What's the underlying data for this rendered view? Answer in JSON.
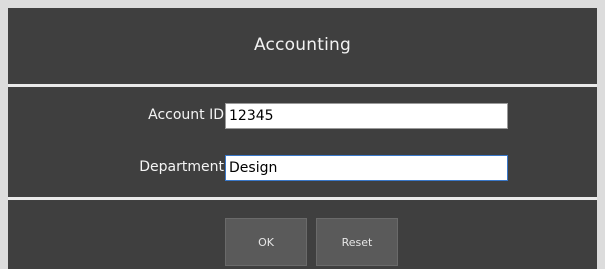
{
  "header": {
    "title": "Accounting"
  },
  "form": {
    "account_id": {
      "label": "Account ID",
      "value": "12345"
    },
    "department": {
      "label": "Department",
      "value": "Design"
    }
  },
  "buttons": {
    "ok_label": "OK",
    "reset_label": "Reset"
  },
  "colors": {
    "panel_background": "#404040",
    "divider": "#eaeaea",
    "button_background": "#5a5a5a",
    "text": "#f2f2f2"
  }
}
